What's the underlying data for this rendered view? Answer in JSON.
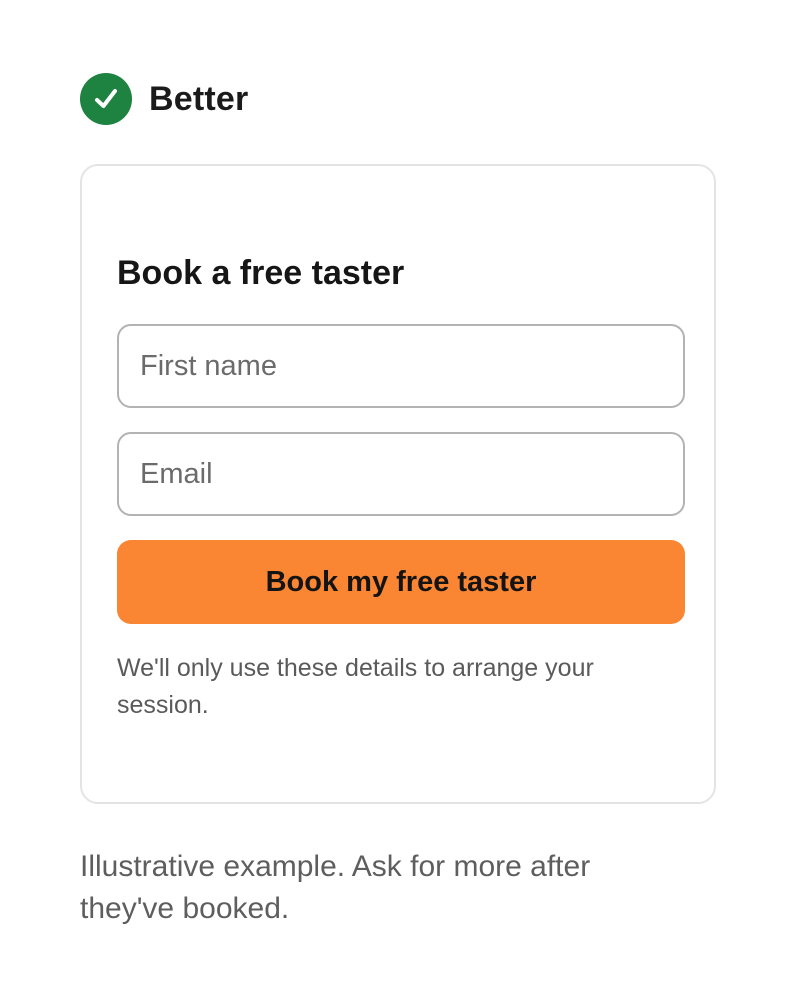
{
  "header": {
    "label": "Better",
    "icon": "check-circle-icon",
    "accent_color": "#1e8240"
  },
  "form": {
    "title": "Book a free taster",
    "first_name": {
      "placeholder": "First name",
      "value": ""
    },
    "email": {
      "placeholder": "Email",
      "value": ""
    },
    "submit_label": "Book my free taster",
    "submit_color": "#fa8533",
    "privacy_note": "We'll only use these details to arrange your session."
  },
  "caption": "Illustrative example. Ask for more after they've booked."
}
